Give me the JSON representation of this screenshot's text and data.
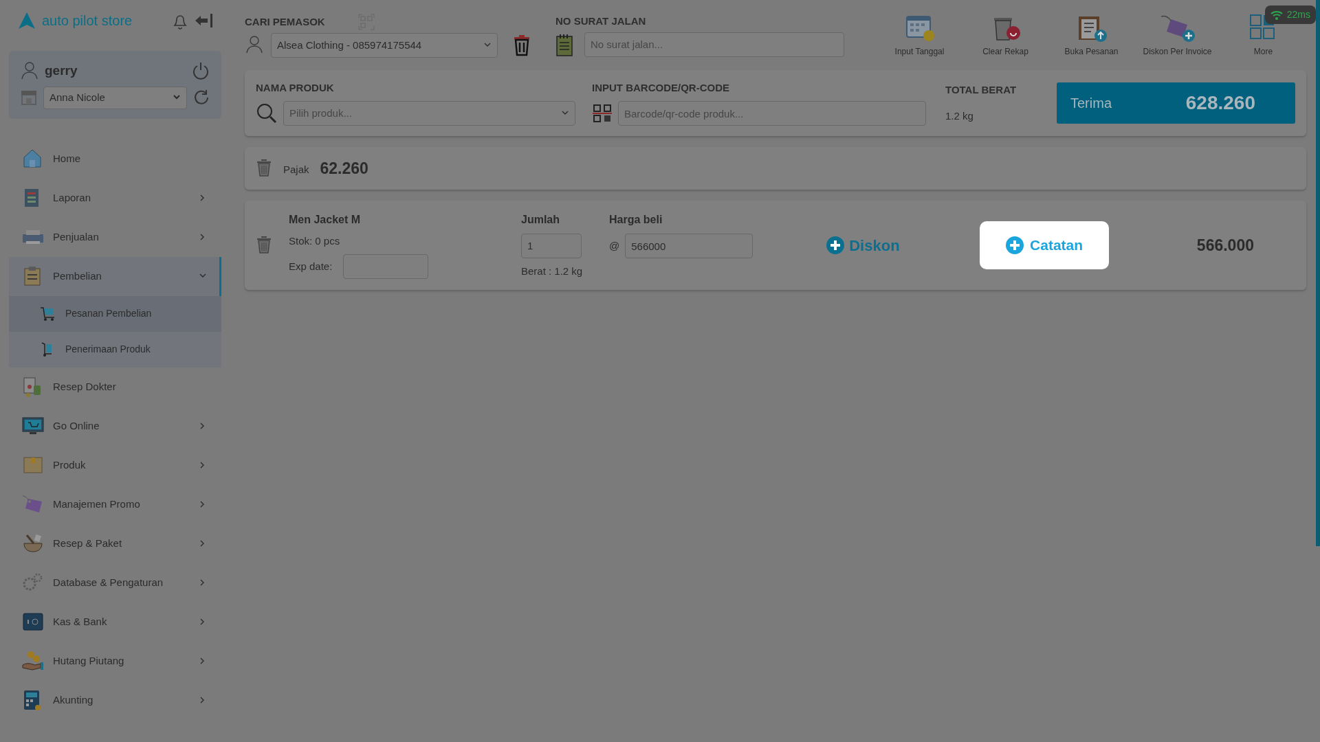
{
  "brand": {
    "name": "auto pilot store"
  },
  "user": {
    "name": "gerry",
    "outlet": "Anna Nicole"
  },
  "sidebar": {
    "items": [
      {
        "label": "Home",
        "kind": "link",
        "selected": false
      },
      {
        "label": "Laporan",
        "kind": "group",
        "expanded": false,
        "selected": false
      },
      {
        "label": "Penjualan",
        "kind": "group",
        "expanded": false,
        "selected": false
      },
      {
        "label": "Pembelian",
        "kind": "group",
        "expanded": true,
        "selected": true,
        "children": [
          {
            "label": "Pesanan Pembelian",
            "selected": true
          },
          {
            "label": "Penerimaan Produk",
            "selected": false
          }
        ]
      },
      {
        "label": "Resep Dokter",
        "kind": "link",
        "selected": false
      },
      {
        "label": "Go Online",
        "kind": "group",
        "expanded": false,
        "selected": false
      },
      {
        "label": "Produk",
        "kind": "group",
        "expanded": false,
        "selected": false
      },
      {
        "label": "Manajemen Promo",
        "kind": "group",
        "expanded": false,
        "selected": false
      },
      {
        "label": "Resep & Paket",
        "kind": "group",
        "expanded": false,
        "selected": false
      },
      {
        "label": "Database & Pengaturan",
        "kind": "group",
        "expanded": false,
        "selected": false
      },
      {
        "label": "Kas & Bank",
        "kind": "group",
        "expanded": false,
        "selected": false
      },
      {
        "label": "Hutang Piutang",
        "kind": "group",
        "expanded": false,
        "selected": false
      },
      {
        "label": "Akunting",
        "kind": "group",
        "expanded": false,
        "selected": false
      }
    ]
  },
  "supplier": {
    "label": "CARI PEMASOK",
    "value": "Alsea Clothing - 085974175544"
  },
  "delivery_note": {
    "label": "NO SURAT JALAN",
    "placeholder": "No surat jalan..."
  },
  "toolbar": [
    {
      "label": "Input Tanggal"
    },
    {
      "label": "Clear Rekap"
    },
    {
      "label": "Buka Pesanan"
    },
    {
      "label": "Diskon Per Invoice"
    },
    {
      "label": "More"
    }
  ],
  "latency": "22ms",
  "product_search": {
    "label": "NAMA PRODUK",
    "placeholder": "Pilih produk..."
  },
  "barcode": {
    "label": "INPUT BARCODE/QR-CODE",
    "placeholder": "Barcode/qr-code produk..."
  },
  "total_weight": {
    "label": "TOTAL BERAT",
    "value": "1.2 kg"
  },
  "receive_button": {
    "label": "Terima",
    "amount": "628.260"
  },
  "tax": {
    "label": "Pajak",
    "amount": "62.260"
  },
  "lines": [
    {
      "name": "Men Jacket M",
      "stock": "Stok: 0 pcs",
      "exp_label": "Exp date:",
      "qty_label": "Jumlah",
      "qty": "1",
      "weight": "Berat : 1.2 kg",
      "price_label": "Harga beli",
      "price_prefix": "@",
      "price": "566000",
      "discount": "Diskon",
      "note": {
        "label": "Catatan",
        "highlighted": true
      },
      "total": "566.000"
    }
  ]
}
